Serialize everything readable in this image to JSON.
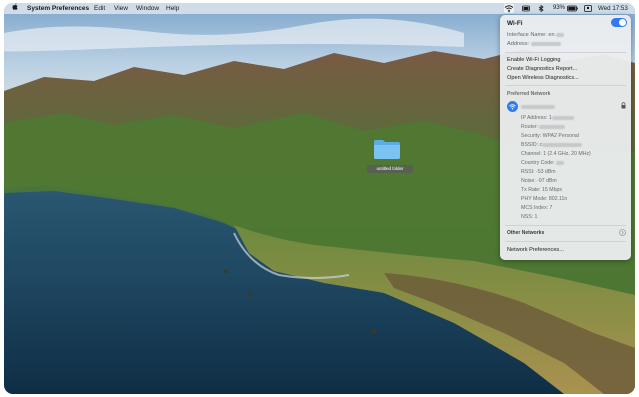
{
  "menubar": {
    "apple_icon": "apple-logo-icon",
    "app_name": "System Preferences",
    "menus": [
      "Edit",
      "View",
      "Window",
      "Help"
    ],
    "battery_percent": "93%",
    "clock": "Wed 17:53"
  },
  "desktop": {
    "folder_label": "untitled folder"
  },
  "wifi_menu": {
    "title": "Wi-Fi",
    "toggle_on": true,
    "interface_name_label": "Interface Name: en",
    "address_label": "Address:",
    "enable_logging": "Enable Wi-Fi Logging",
    "create_report": "Create Diagnostics Report...",
    "open_diagnostics": "Open Wireless Diagnostics...",
    "preferred_section": "Preferred Network",
    "details": [
      "IP Address: 1",
      "Router:",
      "Security: WPA2 Personal",
      "BSSID: c",
      "Channel: 1 (2.4 GHz, 20 MHz)",
      "Country Code:",
      "RSSI: -53 dBm",
      "Noise: -97 dBm",
      "Tx Rate: 15 Mbps",
      "PHY Mode: 802.11n",
      "MCS Index: 7",
      "NSS: 1"
    ],
    "other_networks": "Other Networks",
    "network_preferences": "Network Preferences..."
  },
  "colors": {
    "accent": "#2f7bf6",
    "menu_bg": "#eceef0"
  }
}
